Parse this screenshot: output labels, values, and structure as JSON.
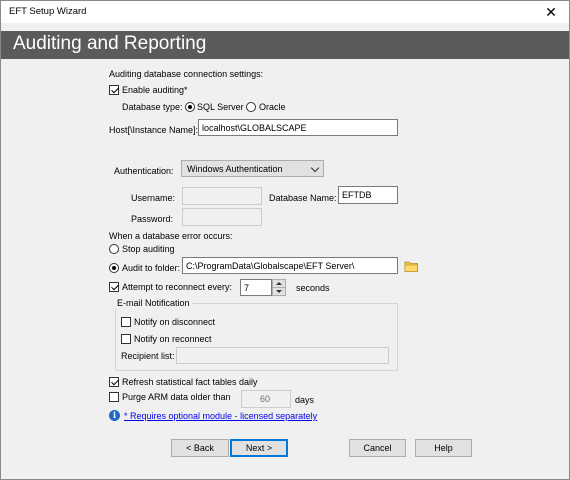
{
  "window": {
    "title": "EFT Setup Wizard",
    "close_glyph": "✕"
  },
  "banner": {
    "title": "Auditing and Reporting"
  },
  "connection": {
    "section_label": "Auditing database connection settings:",
    "enable_auditing_label": "Enable auditing*",
    "enable_auditing_checked": true,
    "db_type_label": "Database type:",
    "db_types": [
      {
        "label": "SQL Server",
        "selected": true
      },
      {
        "label": "Oracle",
        "selected": false
      }
    ],
    "host_label": "Host[\\Instance Name]:",
    "host_value": "localhost\\GLOBALSCAPE"
  },
  "auth": {
    "label": "Authentication:",
    "selected": "Windows Authentication",
    "username_label": "Username:",
    "username_value": "",
    "dbname_label": "Database Name:",
    "dbname_value": "EFTDB",
    "password_label": "Password:",
    "password_value": ""
  },
  "error": {
    "section_label": "When a database error occurs:",
    "stop_label": "Stop auditing",
    "stop_selected": false,
    "audit_folder_label": "Audit to folder:",
    "audit_folder_selected": true,
    "audit_folder_value": "C:\\ProgramData\\Globalscape\\EFT Server\\",
    "reconnect_label": "Attempt to reconnect every:",
    "reconnect_checked": true,
    "reconnect_value": "7",
    "reconnect_unit": "seconds"
  },
  "email": {
    "group_label": "E-mail Notification",
    "notify_disconnect_label": "Notify on disconnect",
    "notify_disconnect_checked": false,
    "notify_reconnect_label": "Notify on reconnect",
    "notify_reconnect_checked": false,
    "recipient_label": "Recipient list:",
    "recipient_value": ""
  },
  "arm": {
    "refresh_label": "Refresh statistical fact tables daily",
    "refresh_checked": true,
    "purge_label": "Purge ARM data older than",
    "purge_checked": false,
    "purge_value": "60",
    "purge_unit": "days",
    "info_glyph": "i",
    "note_link": "* Requires optional module - licensed separately"
  },
  "buttons": {
    "back": "< Back",
    "next": "Next >",
    "cancel": "Cancel",
    "help": "Help"
  },
  "colors": {
    "banner": "#5b5b5b",
    "link": "#0000ee",
    "default_button_border": "#0078d7"
  }
}
